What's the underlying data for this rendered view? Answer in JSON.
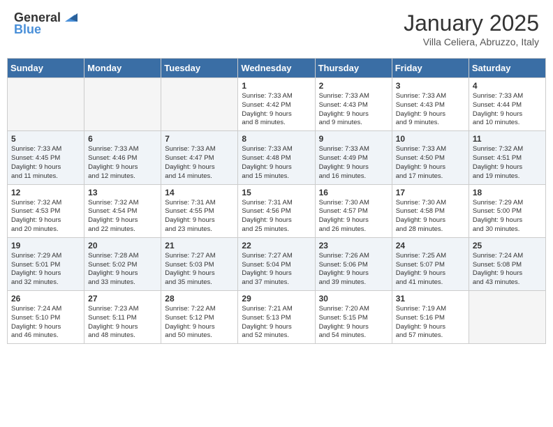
{
  "header": {
    "logo_general": "General",
    "logo_blue": "Blue",
    "month_title": "January 2025",
    "subtitle": "Villa Celiera, Abruzzo, Italy"
  },
  "weekdays": [
    "Sunday",
    "Monday",
    "Tuesday",
    "Wednesday",
    "Thursday",
    "Friday",
    "Saturday"
  ],
  "weeks": [
    [
      {
        "day": "",
        "info": ""
      },
      {
        "day": "",
        "info": ""
      },
      {
        "day": "",
        "info": ""
      },
      {
        "day": "1",
        "info": "Sunrise: 7:33 AM\nSunset: 4:42 PM\nDaylight: 9 hours\nand 8 minutes."
      },
      {
        "day": "2",
        "info": "Sunrise: 7:33 AM\nSunset: 4:43 PM\nDaylight: 9 hours\nand 9 minutes."
      },
      {
        "day": "3",
        "info": "Sunrise: 7:33 AM\nSunset: 4:43 PM\nDaylight: 9 hours\nand 9 minutes."
      },
      {
        "day": "4",
        "info": "Sunrise: 7:33 AM\nSunset: 4:44 PM\nDaylight: 9 hours\nand 10 minutes."
      }
    ],
    [
      {
        "day": "5",
        "info": "Sunrise: 7:33 AM\nSunset: 4:45 PM\nDaylight: 9 hours\nand 11 minutes."
      },
      {
        "day": "6",
        "info": "Sunrise: 7:33 AM\nSunset: 4:46 PM\nDaylight: 9 hours\nand 12 minutes."
      },
      {
        "day": "7",
        "info": "Sunrise: 7:33 AM\nSunset: 4:47 PM\nDaylight: 9 hours\nand 14 minutes."
      },
      {
        "day": "8",
        "info": "Sunrise: 7:33 AM\nSunset: 4:48 PM\nDaylight: 9 hours\nand 15 minutes."
      },
      {
        "day": "9",
        "info": "Sunrise: 7:33 AM\nSunset: 4:49 PM\nDaylight: 9 hours\nand 16 minutes."
      },
      {
        "day": "10",
        "info": "Sunrise: 7:33 AM\nSunset: 4:50 PM\nDaylight: 9 hours\nand 17 minutes."
      },
      {
        "day": "11",
        "info": "Sunrise: 7:32 AM\nSunset: 4:51 PM\nDaylight: 9 hours\nand 19 minutes."
      }
    ],
    [
      {
        "day": "12",
        "info": "Sunrise: 7:32 AM\nSunset: 4:53 PM\nDaylight: 9 hours\nand 20 minutes."
      },
      {
        "day": "13",
        "info": "Sunrise: 7:32 AM\nSunset: 4:54 PM\nDaylight: 9 hours\nand 22 minutes."
      },
      {
        "day": "14",
        "info": "Sunrise: 7:31 AM\nSunset: 4:55 PM\nDaylight: 9 hours\nand 23 minutes."
      },
      {
        "day": "15",
        "info": "Sunrise: 7:31 AM\nSunset: 4:56 PM\nDaylight: 9 hours\nand 25 minutes."
      },
      {
        "day": "16",
        "info": "Sunrise: 7:30 AM\nSunset: 4:57 PM\nDaylight: 9 hours\nand 26 minutes."
      },
      {
        "day": "17",
        "info": "Sunrise: 7:30 AM\nSunset: 4:58 PM\nDaylight: 9 hours\nand 28 minutes."
      },
      {
        "day": "18",
        "info": "Sunrise: 7:29 AM\nSunset: 5:00 PM\nDaylight: 9 hours\nand 30 minutes."
      }
    ],
    [
      {
        "day": "19",
        "info": "Sunrise: 7:29 AM\nSunset: 5:01 PM\nDaylight: 9 hours\nand 32 minutes."
      },
      {
        "day": "20",
        "info": "Sunrise: 7:28 AM\nSunset: 5:02 PM\nDaylight: 9 hours\nand 33 minutes."
      },
      {
        "day": "21",
        "info": "Sunrise: 7:27 AM\nSunset: 5:03 PM\nDaylight: 9 hours\nand 35 minutes."
      },
      {
        "day": "22",
        "info": "Sunrise: 7:27 AM\nSunset: 5:04 PM\nDaylight: 9 hours\nand 37 minutes."
      },
      {
        "day": "23",
        "info": "Sunrise: 7:26 AM\nSunset: 5:06 PM\nDaylight: 9 hours\nand 39 minutes."
      },
      {
        "day": "24",
        "info": "Sunrise: 7:25 AM\nSunset: 5:07 PM\nDaylight: 9 hours\nand 41 minutes."
      },
      {
        "day": "25",
        "info": "Sunrise: 7:24 AM\nSunset: 5:08 PM\nDaylight: 9 hours\nand 43 minutes."
      }
    ],
    [
      {
        "day": "26",
        "info": "Sunrise: 7:24 AM\nSunset: 5:10 PM\nDaylight: 9 hours\nand 46 minutes."
      },
      {
        "day": "27",
        "info": "Sunrise: 7:23 AM\nSunset: 5:11 PM\nDaylight: 9 hours\nand 48 minutes."
      },
      {
        "day": "28",
        "info": "Sunrise: 7:22 AM\nSunset: 5:12 PM\nDaylight: 9 hours\nand 50 minutes."
      },
      {
        "day": "29",
        "info": "Sunrise: 7:21 AM\nSunset: 5:13 PM\nDaylight: 9 hours\nand 52 minutes."
      },
      {
        "day": "30",
        "info": "Sunrise: 7:20 AM\nSunset: 5:15 PM\nDaylight: 9 hours\nand 54 minutes."
      },
      {
        "day": "31",
        "info": "Sunrise: 7:19 AM\nSunset: 5:16 PM\nDaylight: 9 hours\nand 57 minutes."
      },
      {
        "day": "",
        "info": ""
      }
    ]
  ]
}
